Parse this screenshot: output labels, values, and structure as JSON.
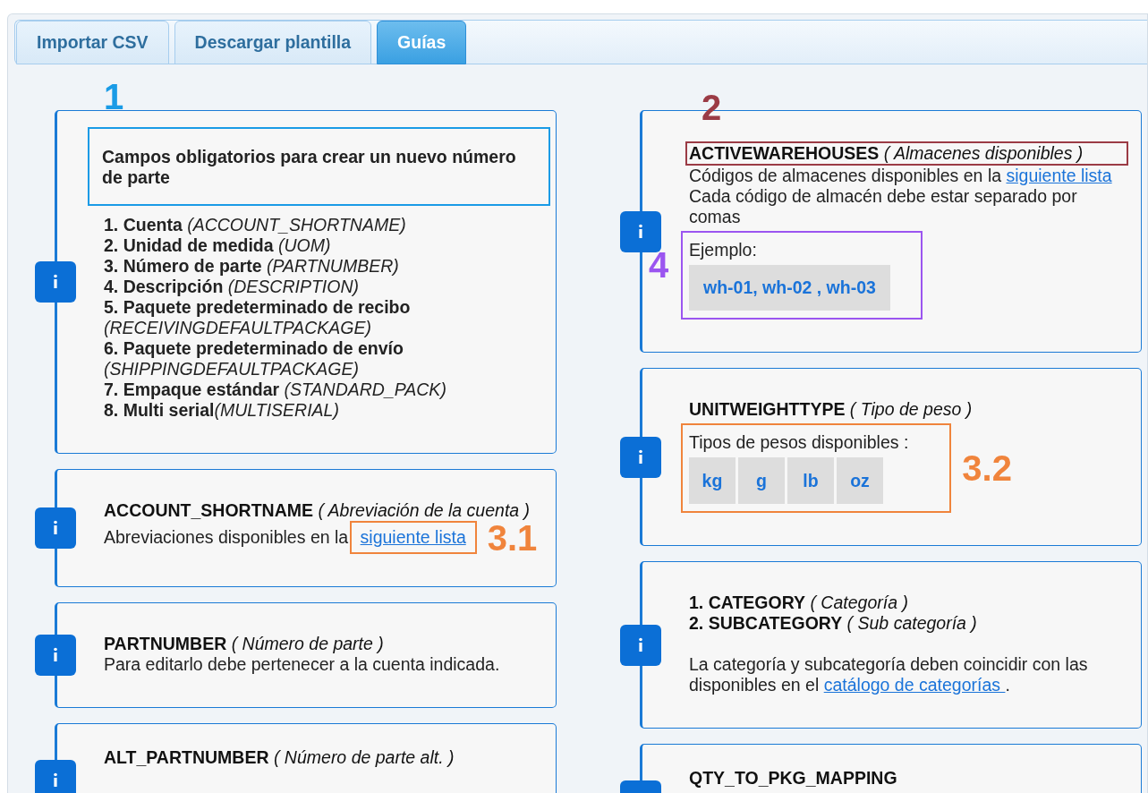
{
  "tabs": [
    {
      "label": "Importar CSV",
      "selected": false
    },
    {
      "label": "Descargar plantilla",
      "selected": false
    },
    {
      "label": "Guías",
      "selected": true
    }
  ],
  "columns": [
    {
      "cards": [
        {
          "blocks": [
            {
              "kind": "heading",
              "text": "Campos obligatorios para crear un nuevo número de parte",
              "annotation": {
                "label": "1",
                "color": "#1a9be6"
              }
            },
            {
              "kind": "list",
              "items": [
                {
                  "label": "1. Cuenta",
                  "code": " (ACCOUNT_SHORTNAME)"
                },
                {
                  "label": "2. Unidad de medida",
                  "code": " (UOM)"
                },
                {
                  "label": "3. Número de parte",
                  "code": " (PARTNUMBER)"
                },
                {
                  "label": "4. Descripción",
                  "code": " (DESCRIPTION)"
                },
                {
                  "label": "5. Paquete predeterminado de recibo",
                  "code": " (RECEIVINGDEFAULTPACKAGE)"
                },
                {
                  "label": "6. Paquete predeterminado de envío",
                  "code": " (SHIPPINGDEFAULTPACKAGE)"
                },
                {
                  "label": "7. Empaque estándar",
                  "code": " (STANDARD_PACK)"
                },
                {
                  "label": "8. Multi serial",
                  "code": "(MULTISERIAL)"
                }
              ]
            }
          ]
        },
        {
          "blocks": [
            {
              "kind": "title",
              "text": "**ACCOUNT_SHORTNAME** *( Abreviación de la cuenta )*"
            },
            {
              "kind": "text",
              "parts": [
                {
                  "text": "Abreviaciones disponibles en la "
                },
                {
                  "link": "siguiente lista",
                  "annotation": {
                    "label": "3.1",
                    "color": "#f0843c"
                  }
                }
              ]
            }
          ]
        },
        {
          "blocks": [
            {
              "kind": "title",
              "text": "**PARTNUMBER** *( Número de parte )*"
            },
            {
              "kind": "text",
              "parts": [
                {
                  "text": "Para editarlo debe pertenecer a la cuenta indicada."
                }
              ]
            }
          ]
        },
        {
          "blocks": [
            {
              "kind": "title",
              "text": "**ALT_PARTNUMBER** *( Número de parte alt. )*"
            }
          ]
        }
      ]
    },
    {
      "cards": [
        {
          "blocks": [
            {
              "kind": "title",
              "text": "**ACTIVEWAREHOUSES** *( Almacenes disponibles )*",
              "annotation": {
                "label": "2",
                "color": "#9b3b45"
              }
            },
            {
              "kind": "text",
              "parts": [
                {
                  "text": "Códigos de almacenes disponibles en la "
                },
                {
                  "link": "siguiente lista"
                }
              ]
            },
            {
              "kind": "text",
              "parts": [
                {
                  "text": "Cada código de almacén debe estar separado por comas"
                }
              ]
            },
            {
              "kind": "example",
              "label": "Ejemplo:",
              "value": "wh-01, wh-02 , wh-03",
              "annotation": {
                "label": "4",
                "color": "#9b55f0"
              }
            }
          ]
        },
        {
          "blocks": [
            {
              "kind": "title",
              "text": "**UNITWEIGHTTYPE** *( Tipo de peso )*"
            },
            {
              "kind": "chips",
              "label": "Tipos de pesos disponibles :",
              "chips": [
                "kg",
                "g",
                "lb",
                "oz"
              ],
              "annotation": {
                "label": "3.2",
                "color": "#f0843c"
              }
            }
          ]
        },
        {
          "blocks": [
            {
              "kind": "title",
              "text": "**1. CATEGORY** *( Categoría )*"
            },
            {
              "kind": "title",
              "text": "**2. SUBCATEGORY** *( Sub categoría )*"
            },
            {
              "kind": "spacer"
            },
            {
              "kind": "text",
              "parts": [
                {
                  "text": "La categoría y subcategoría deben coincidir con las disponibles en el "
                },
                {
                  "link": "catálogo de categorías "
                },
                {
                  "text": "."
                }
              ]
            }
          ]
        },
        {
          "blocks": [
            {
              "kind": "title",
              "text": "**QTY_TO_PKG_MAPPING**"
            }
          ]
        }
      ]
    }
  ]
}
